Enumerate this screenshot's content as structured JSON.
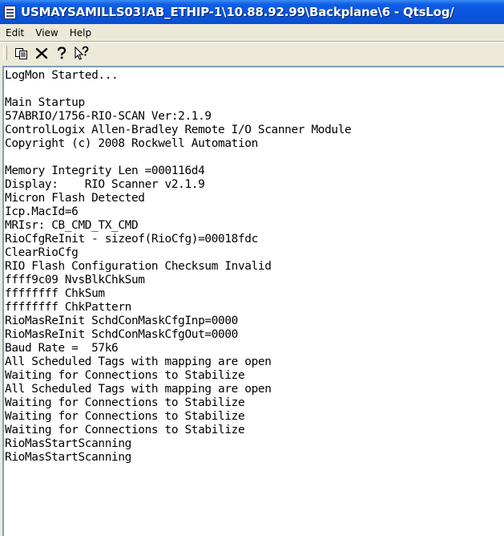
{
  "window": {
    "title": "USMAYSAMILLS03!AB_ETHIP-1\\10.88.92.99\\Backplane\\6 - QtsLog/"
  },
  "menu": {
    "items": [
      "Edit",
      "View",
      "Help"
    ]
  },
  "toolbar": {
    "buttons": [
      {
        "name": "copy-icon"
      },
      {
        "name": "delete-icon"
      },
      {
        "name": "help-icon"
      },
      {
        "name": "context-help-icon"
      }
    ]
  },
  "log": {
    "lines": [
      "LogMon Started...",
      "",
      "Main Startup",
      "57ABRIO/1756-RIO-SCAN Ver:2.1.9",
      "ControlLogix Allen-Bradley Remote I/O Scanner Module",
      "Copyright (c) 2008 Rockwell Automation",
      "",
      "Memory Integrity Len =000116d4",
      "Display:    RIO Scanner v2.1.9",
      "Micron Flash Detected",
      "Icp.MacId=6",
      "MRIsr: CB_CMD_TX_CMD",
      "RioCfgReInit - sizeof(RioCfg)=00018fdc",
      "ClearRioCfg",
      "RIO Flash Configuration Checksum Invalid",
      "ffff9c09 NvsBlkChkSum",
      "ffffffff ChkSum",
      "ffffffff ChkPattern",
      "RioMasReInit SchdConMaskCfgInp=0000",
      "RioMasReInit SchdConMaskCfgOut=0000",
      "Baud Rate =  57k6",
      "All Scheduled Tags with mapping are open",
      "Waiting for Connections to Stabilize",
      "All Scheduled Tags with mapping are open",
      "Waiting for Connections to Stabilize",
      "Waiting for Connections to Stabilize",
      "Waiting for Connections to Stabilize",
      "RioMasStartScanning",
      "RioMasStartScanning"
    ]
  }
}
